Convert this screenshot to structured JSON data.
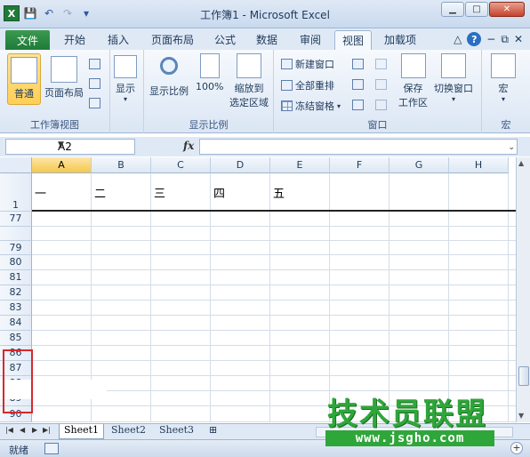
{
  "window": {
    "title": "工作簿1 - Microsoft Excel",
    "min_label": "▁",
    "max_label": "□",
    "close_label": "✕"
  },
  "qat": {
    "logo": "X",
    "save": "💾",
    "undo": "↶",
    "redo": "↷",
    "customize": "▾"
  },
  "ribbon_tabs": {
    "file": "文件",
    "tabs": [
      "开始",
      "插入",
      "页面布局",
      "公式",
      "数据",
      "审阅",
      "视图",
      "加载项"
    ],
    "active": "视图"
  },
  "ribbon": {
    "workbook_views": {
      "label": "工作簿视图",
      "normal": "普通",
      "page_layout": "页面布局"
    },
    "show": {
      "label": "显示"
    },
    "zoom": {
      "label": "显示比例",
      "zoom": "显示比例",
      "hundred": "100%",
      "zoom_to_selection_1": "缩放到",
      "zoom_to_selection_2": "选定区域"
    },
    "window": {
      "label": "窗口",
      "new_window": "新建窗口",
      "arrange_all": "全部重排",
      "freeze_panes": "冻结窗格",
      "save_workspace_1": "保存",
      "save_workspace_2": "工作区",
      "switch_windows": "切换窗口"
    },
    "macros": {
      "label": "宏",
      "macro": "宏"
    }
  },
  "formula_bar": {
    "name_box": "A2",
    "fx": "fx",
    "value": ""
  },
  "sheet": {
    "columns": [
      "A",
      "B",
      "C",
      "D",
      "E",
      "F",
      "G",
      "H"
    ],
    "selected_column": "A",
    "rows": [
      "1",
      "77",
      "",
      "79",
      "80",
      "81",
      "82",
      "83",
      "84",
      "85",
      "86",
      "87",
      "88",
      "89",
      "90"
    ],
    "row1_cells": [
      "一",
      "二",
      "三",
      "四",
      "五"
    ]
  },
  "sheet_tabs": {
    "tabs": [
      "Sheet1",
      "Sheet2",
      "Sheet3"
    ],
    "active": "Sheet1"
  },
  "status": {
    "ready": "就绪"
  },
  "watermark": {
    "title": "技术员联盟",
    "url": "www.jsgho.com"
  }
}
